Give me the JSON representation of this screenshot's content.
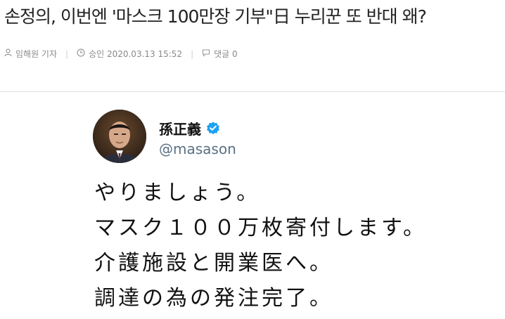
{
  "article": {
    "headline": "손정의, 이번엔 '마스크 100만장 기부\"日 누리꾼 또 반대 왜?",
    "reporter": "임해원 기자",
    "approval": "승인 2020.03.13 15:52",
    "comments": "댓글 0",
    "icons": [
      "person-icon",
      "clock-icon",
      "comment-icon"
    ]
  },
  "tweet": {
    "display_name": "孫正義",
    "handle": "@masason",
    "verified": true,
    "verified_color": "#1da1f2",
    "lines": [
      "やりましょう。",
      "マスク１００万枚寄付します。",
      "介護施設と開業医へ。",
      "調達の為の発注完了。"
    ]
  }
}
